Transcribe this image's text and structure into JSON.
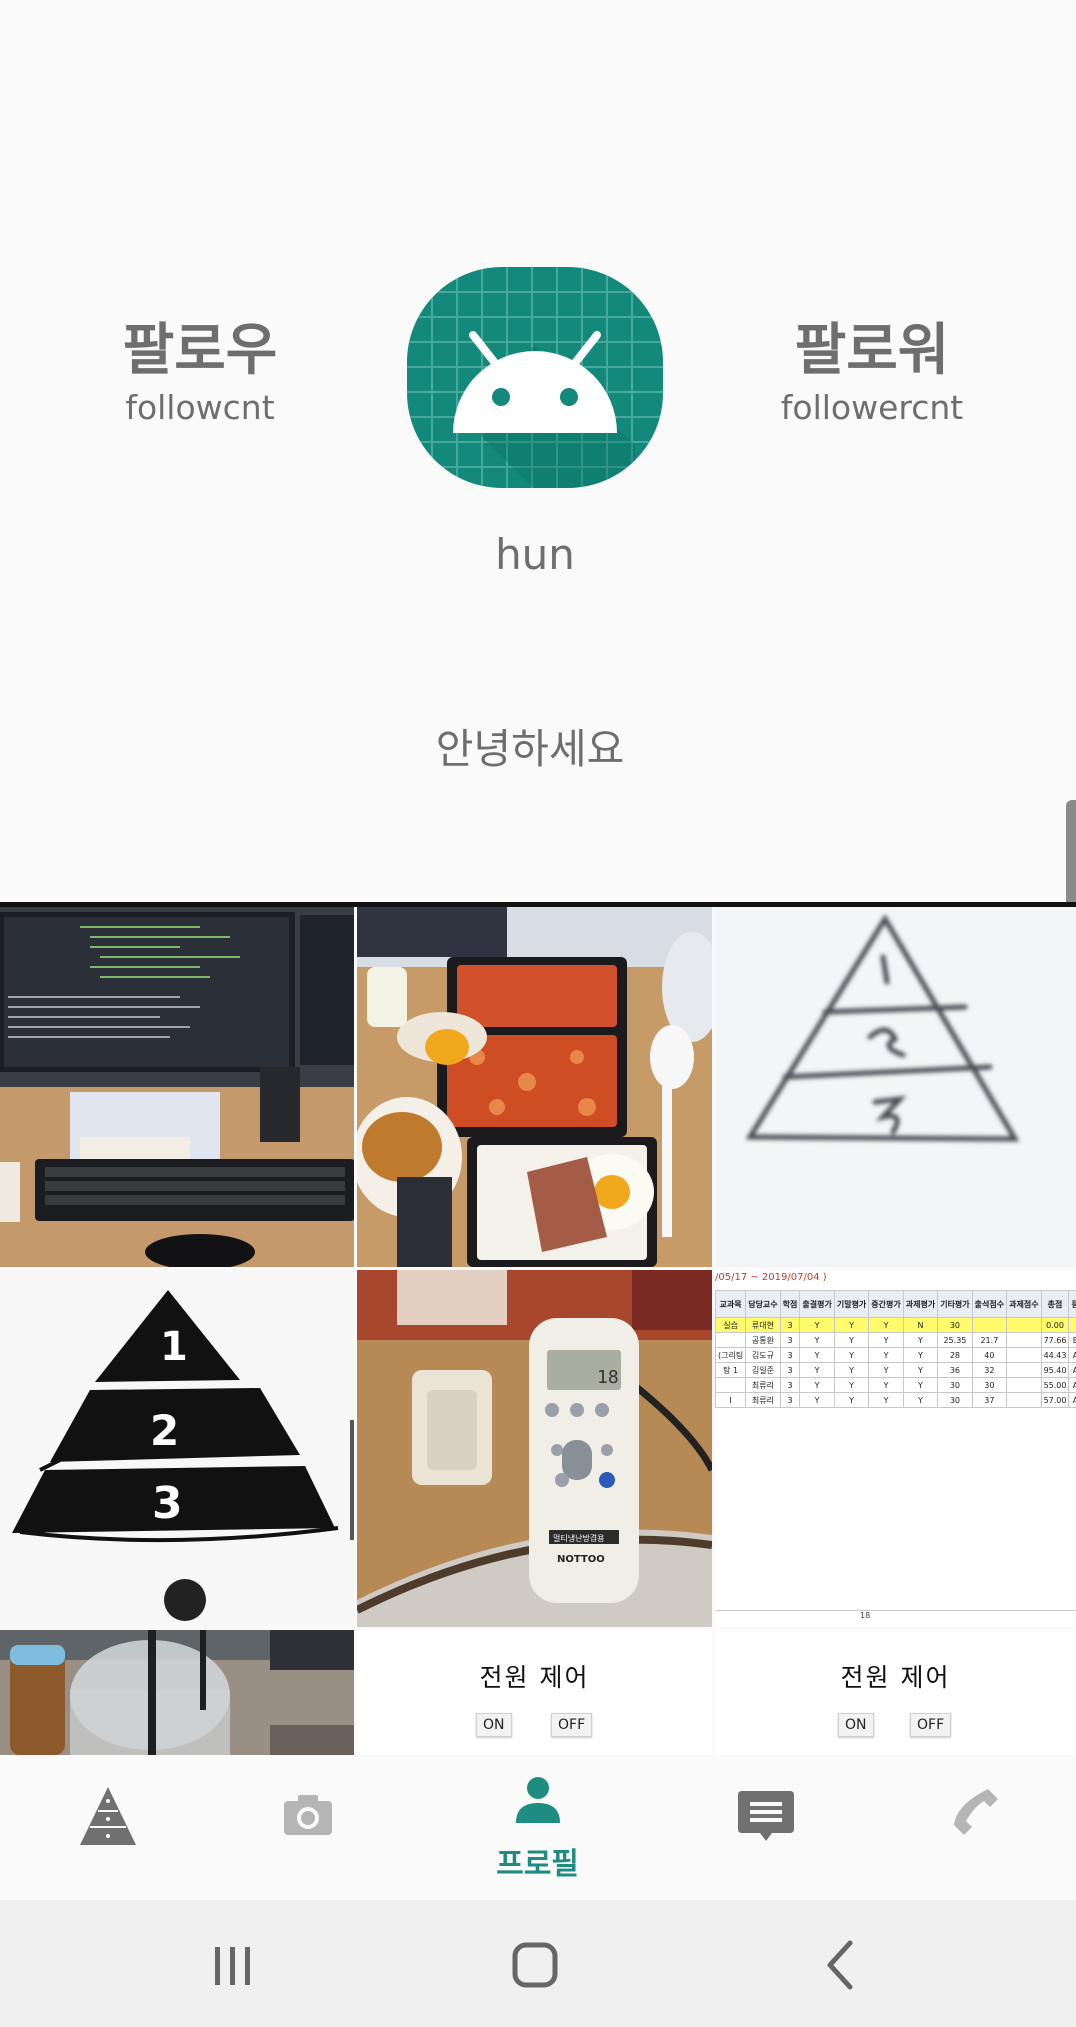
{
  "profile": {
    "follow_label": "팔로우",
    "follow_count": "followcnt",
    "follower_label": "팔로워",
    "follower_count": "followercnt",
    "username": "hun",
    "bio": "안녕하세요"
  },
  "grid": {
    "tiles": [
      {
        "type": "photo",
        "icon": "desk-computer-photo"
      },
      {
        "type": "photo",
        "icon": "lunchbox-food-photo"
      },
      {
        "type": "photo",
        "icon": "pyramid-sketch-blurry-photo"
      },
      {
        "type": "photo",
        "icon": "pyramid-drawing-photo"
      },
      {
        "type": "photo",
        "icon": "aircon-remote-photo"
      },
      {
        "type": "photo",
        "icon": "grade-table-screenshot"
      },
      {
        "type": "photo",
        "icon": "drink-cup-photo"
      },
      {
        "type": "control",
        "title": "전원  제어",
        "on_label": "ON",
        "off_label": "OFF"
      },
      {
        "type": "control",
        "title": "전원  제어",
        "on_label": "ON",
        "off_label": "OFF"
      }
    ],
    "pyramid_numbers": [
      "1",
      "2",
      "3"
    ],
    "remote_brand": "NOTTOO",
    "remote_label": "멀티냉난방겸용",
    "remote_display": "18",
    "grade_screenshot": {
      "caption": "/05/17 ~ 2019/07/04 )",
      "headers": [
        "교과목",
        "담당교수",
        "학점",
        "출결평가",
        "기말평가",
        "중간평가",
        "과제평가",
        "기타평가",
        "출석점수",
        "과제점수",
        "총점",
        "등급"
      ],
      "rows": [
        [
          "실습",
          "류대현",
          "3",
          "Y",
          "Y",
          "Y",
          "N",
          "30",
          "",
          "",
          "0.00",
          ""
        ],
        [
          "",
          "공통환",
          "3",
          "Y",
          "Y",
          "Y",
          "Y",
          "25.35",
          "21.7",
          "",
          "77.66",
          "B+"
        ],
        [
          "(그리팅",
          "김도규",
          "3",
          "Y",
          "Y",
          "Y",
          "Y",
          "28",
          "40",
          "",
          "44.43",
          "A+"
        ],
        [
          "탕 1",
          "김일준",
          "3",
          "Y",
          "Y",
          "Y",
          "Y",
          "36",
          "32",
          "",
          "95.40",
          "A+"
        ],
        [
          "",
          "최류리",
          "3",
          "Y",
          "Y",
          "Y",
          "Y",
          "30",
          "30",
          "",
          "55.00",
          "A+"
        ],
        [
          "I",
          "최류리",
          "3",
          "Y",
          "Y",
          "Y",
          "Y",
          "30",
          "37",
          "",
          "57.00",
          "A+"
        ]
      ],
      "footer_value": "18"
    }
  },
  "nav": {
    "items": [
      {
        "icon": "pyramid-icon",
        "label": ""
      },
      {
        "icon": "camera-icon",
        "label": ""
      },
      {
        "icon": "person-icon",
        "label": "프로필"
      },
      {
        "icon": "chat-icon",
        "label": ""
      },
      {
        "icon": "phone-icon",
        "label": ""
      }
    ],
    "active_index": 2
  },
  "system_bar": {
    "buttons": [
      "recent-apps-icon",
      "home-icon",
      "back-icon"
    ]
  },
  "colors": {
    "accent": "#1e8c80",
    "avatar_bg": "#13897b",
    "text_gray": "#6e6e6e",
    "inactive_icon": "#b5b5b5"
  }
}
